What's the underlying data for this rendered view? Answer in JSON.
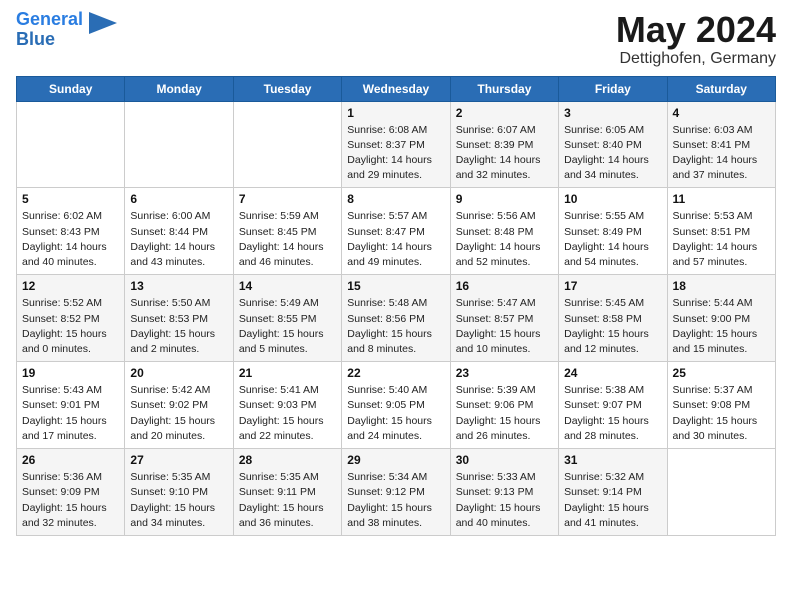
{
  "header": {
    "logo_line1": "General",
    "logo_line2": "Blue",
    "month": "May 2024",
    "location": "Dettighofen, Germany"
  },
  "weekdays": [
    "Sunday",
    "Monday",
    "Tuesday",
    "Wednesday",
    "Thursday",
    "Friday",
    "Saturday"
  ],
  "weeks": [
    [
      {
        "day": "",
        "info": ""
      },
      {
        "day": "",
        "info": ""
      },
      {
        "day": "",
        "info": ""
      },
      {
        "day": "1",
        "info": "Sunrise: 6:08 AM\nSunset: 8:37 PM\nDaylight: 14 hours\nand 29 minutes."
      },
      {
        "day": "2",
        "info": "Sunrise: 6:07 AM\nSunset: 8:39 PM\nDaylight: 14 hours\nand 32 minutes."
      },
      {
        "day": "3",
        "info": "Sunrise: 6:05 AM\nSunset: 8:40 PM\nDaylight: 14 hours\nand 34 minutes."
      },
      {
        "day": "4",
        "info": "Sunrise: 6:03 AM\nSunset: 8:41 PM\nDaylight: 14 hours\nand 37 minutes."
      }
    ],
    [
      {
        "day": "5",
        "info": "Sunrise: 6:02 AM\nSunset: 8:43 PM\nDaylight: 14 hours\nand 40 minutes."
      },
      {
        "day": "6",
        "info": "Sunrise: 6:00 AM\nSunset: 8:44 PM\nDaylight: 14 hours\nand 43 minutes."
      },
      {
        "day": "7",
        "info": "Sunrise: 5:59 AM\nSunset: 8:45 PM\nDaylight: 14 hours\nand 46 minutes."
      },
      {
        "day": "8",
        "info": "Sunrise: 5:57 AM\nSunset: 8:47 PM\nDaylight: 14 hours\nand 49 minutes."
      },
      {
        "day": "9",
        "info": "Sunrise: 5:56 AM\nSunset: 8:48 PM\nDaylight: 14 hours\nand 52 minutes."
      },
      {
        "day": "10",
        "info": "Sunrise: 5:55 AM\nSunset: 8:49 PM\nDaylight: 14 hours\nand 54 minutes."
      },
      {
        "day": "11",
        "info": "Sunrise: 5:53 AM\nSunset: 8:51 PM\nDaylight: 14 hours\nand 57 minutes."
      }
    ],
    [
      {
        "day": "12",
        "info": "Sunrise: 5:52 AM\nSunset: 8:52 PM\nDaylight: 15 hours\nand 0 minutes."
      },
      {
        "day": "13",
        "info": "Sunrise: 5:50 AM\nSunset: 8:53 PM\nDaylight: 15 hours\nand 2 minutes."
      },
      {
        "day": "14",
        "info": "Sunrise: 5:49 AM\nSunset: 8:55 PM\nDaylight: 15 hours\nand 5 minutes."
      },
      {
        "day": "15",
        "info": "Sunrise: 5:48 AM\nSunset: 8:56 PM\nDaylight: 15 hours\nand 8 minutes."
      },
      {
        "day": "16",
        "info": "Sunrise: 5:47 AM\nSunset: 8:57 PM\nDaylight: 15 hours\nand 10 minutes."
      },
      {
        "day": "17",
        "info": "Sunrise: 5:45 AM\nSunset: 8:58 PM\nDaylight: 15 hours\nand 12 minutes."
      },
      {
        "day": "18",
        "info": "Sunrise: 5:44 AM\nSunset: 9:00 PM\nDaylight: 15 hours\nand 15 minutes."
      }
    ],
    [
      {
        "day": "19",
        "info": "Sunrise: 5:43 AM\nSunset: 9:01 PM\nDaylight: 15 hours\nand 17 minutes."
      },
      {
        "day": "20",
        "info": "Sunrise: 5:42 AM\nSunset: 9:02 PM\nDaylight: 15 hours\nand 20 minutes."
      },
      {
        "day": "21",
        "info": "Sunrise: 5:41 AM\nSunset: 9:03 PM\nDaylight: 15 hours\nand 22 minutes."
      },
      {
        "day": "22",
        "info": "Sunrise: 5:40 AM\nSunset: 9:05 PM\nDaylight: 15 hours\nand 24 minutes."
      },
      {
        "day": "23",
        "info": "Sunrise: 5:39 AM\nSunset: 9:06 PM\nDaylight: 15 hours\nand 26 minutes."
      },
      {
        "day": "24",
        "info": "Sunrise: 5:38 AM\nSunset: 9:07 PM\nDaylight: 15 hours\nand 28 minutes."
      },
      {
        "day": "25",
        "info": "Sunrise: 5:37 AM\nSunset: 9:08 PM\nDaylight: 15 hours\nand 30 minutes."
      }
    ],
    [
      {
        "day": "26",
        "info": "Sunrise: 5:36 AM\nSunset: 9:09 PM\nDaylight: 15 hours\nand 32 minutes."
      },
      {
        "day": "27",
        "info": "Sunrise: 5:35 AM\nSunset: 9:10 PM\nDaylight: 15 hours\nand 34 minutes."
      },
      {
        "day": "28",
        "info": "Sunrise: 5:35 AM\nSunset: 9:11 PM\nDaylight: 15 hours\nand 36 minutes."
      },
      {
        "day": "29",
        "info": "Sunrise: 5:34 AM\nSunset: 9:12 PM\nDaylight: 15 hours\nand 38 minutes."
      },
      {
        "day": "30",
        "info": "Sunrise: 5:33 AM\nSunset: 9:13 PM\nDaylight: 15 hours\nand 40 minutes."
      },
      {
        "day": "31",
        "info": "Sunrise: 5:32 AM\nSunset: 9:14 PM\nDaylight: 15 hours\nand 41 minutes."
      },
      {
        "day": "",
        "info": ""
      }
    ]
  ]
}
